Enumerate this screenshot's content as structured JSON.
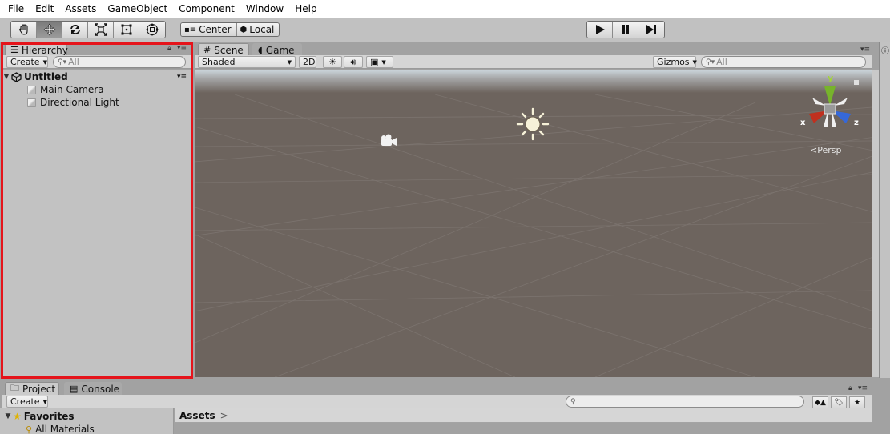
{
  "menubar": {
    "items": [
      "File",
      "Edit",
      "Assets",
      "GameObject",
      "Component",
      "Window",
      "Help"
    ]
  },
  "toolbar": {
    "tools": [
      "hand-tool-icon",
      "move-tool-icon",
      "rotate-tool-icon",
      "scale-tool-icon",
      "rect-tool-icon",
      "transform-tool-icon"
    ],
    "pivot_label": "Center",
    "space_label": "Local",
    "playback": [
      "play-icon",
      "pause-icon",
      "step-icon"
    ]
  },
  "hierarchy": {
    "tab_label": "Hierarchy",
    "create_label": "Create",
    "search_placeholder": "All",
    "scene_name": "Untitled",
    "objects": [
      "Main Camera",
      "Directional Light"
    ]
  },
  "scene": {
    "tab_scene": "Scene",
    "tab_game": "Game",
    "shading": "Shaded",
    "mode_2d": "2D",
    "gizmos_label": "Gizmos",
    "search_placeholder": "All",
    "axis_y": "y",
    "axis_x": "x",
    "axis_z": "z",
    "persp_label": "Persp",
    "colors": {
      "ground": "#6d645e",
      "sky": "#c9d3d9",
      "axis_x": "#c0301f",
      "axis_y": "#77b32b",
      "axis_z": "#3568d9"
    }
  },
  "project": {
    "tab_project": "Project",
    "tab_console": "Console",
    "create_label": "Create",
    "favorites_label": "Favorites",
    "favorites_items": [
      "All Materials"
    ],
    "assets_label": "Assets"
  },
  "highlight_color": "#e5141b"
}
